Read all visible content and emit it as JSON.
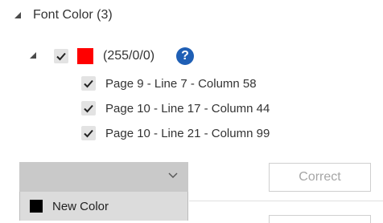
{
  "group": {
    "title": "Font Color (3)"
  },
  "color_entry": {
    "value_text": "(255/0/0)",
    "swatch_color": "#ff0000",
    "help_icon_glyph": "?",
    "checked": true
  },
  "locations": [
    {
      "label": "Page 9 - Line 7 - Column 58",
      "checked": true
    },
    {
      "label": "Page 10 - Line 17 - Column 44",
      "checked": true
    },
    {
      "label": "Page 10 - Line 21 - Column 99",
      "checked": true
    }
  ],
  "replacement_dropdown": {
    "selected_value": "",
    "options": [
      {
        "label": "New Color",
        "swatch_color": "#000000"
      }
    ]
  },
  "actions": {
    "correct_label": "Correct"
  },
  "colors": {
    "accent_help": "#1f5fb5",
    "checkbox_bg": "#e3e3e3",
    "dropdown_bg": "#c9c9c9"
  }
}
